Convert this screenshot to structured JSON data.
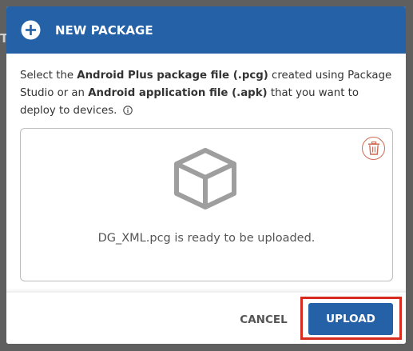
{
  "backdrop": {
    "fragment_text": "T"
  },
  "dialog": {
    "title": "NEW PACKAGE",
    "header_icon": "plus-circle-icon",
    "description": {
      "part1": "Select the ",
      "bold1": "Android Plus package file (.pcg)",
      "part2": " created using Package Studio or an ",
      "bold2": "Android application file (.apk)",
      "part3": " that you want to deploy to devices."
    },
    "info_icon": "info-icon",
    "upload_area": {
      "file_icon": "package-box-icon",
      "delete_icon": "trash-icon",
      "status": "DG_XML.pcg is ready to be uploaded."
    },
    "buttons": {
      "cancel": "CANCEL",
      "upload": "UPLOAD"
    }
  },
  "colors": {
    "header_bg": "#2461a7",
    "primary_button": "#2461a7",
    "highlight_border": "#d62b1e",
    "delete_icon": "#cf6b55"
  }
}
